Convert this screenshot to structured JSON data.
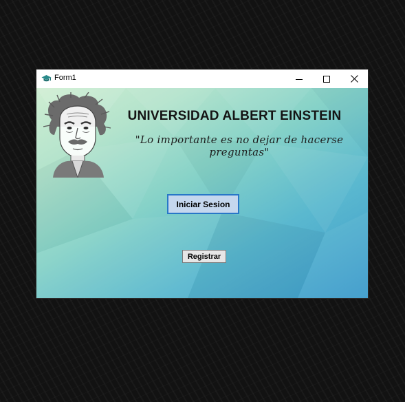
{
  "window": {
    "title": "Form1",
    "controls": {
      "minimize": "minimize-icon",
      "maximize": "maximize-icon",
      "close": "close-icon"
    }
  },
  "form": {
    "heading": "UNIVERSIDAD ALBERT EINSTEIN",
    "quote": "\"Lo importante es no dejar de hacerse preguntas\"",
    "login_button": "Iniciar Sesion",
    "register_button": "Registrar"
  },
  "colors": {
    "login_button_border": "#2877c8",
    "login_button_fill": "#c5d7ee",
    "background_light": "#cfeed2",
    "background_dark": "#3d9bcc"
  }
}
